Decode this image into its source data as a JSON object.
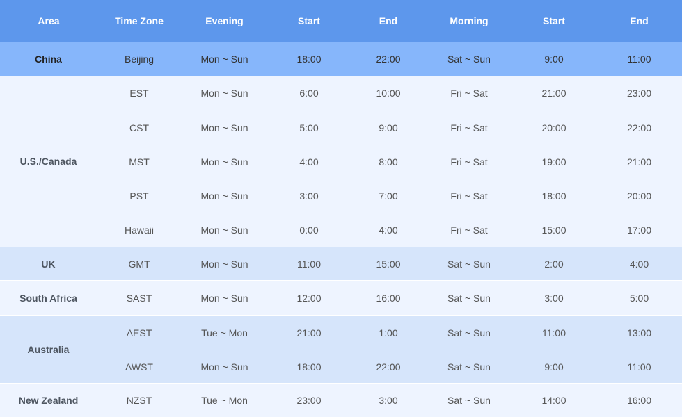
{
  "headers": [
    "Area",
    "Time Zone",
    "Evening",
    "Start",
    "End",
    "Morning",
    "Start",
    "End"
  ],
  "groups": [
    {
      "area": "China",
      "rows": [
        {
          "tz": "Beijing",
          "evening": "Mon ~ Sun",
          "e_start": "18:00",
          "e_end": "22:00",
          "morning": "Sat ~ Sun",
          "m_start": "9:00",
          "m_end": "11:00"
        }
      ]
    },
    {
      "area": "U.S./Canada",
      "rows": [
        {
          "tz": "EST",
          "evening": "Mon ~ Sun",
          "e_start": "6:00",
          "e_end": "10:00",
          "morning": "Fri ~ Sat",
          "m_start": "21:00",
          "m_end": "23:00"
        },
        {
          "tz": "CST",
          "evening": "Mon ~ Sun",
          "e_start": "5:00",
          "e_end": "9:00",
          "morning": "Fri ~ Sat",
          "m_start": "20:00",
          "m_end": "22:00"
        },
        {
          "tz": "MST",
          "evening": "Mon ~ Sun",
          "e_start": "4:00",
          "e_end": "8:00",
          "morning": "Fri ~ Sat",
          "m_start": "19:00",
          "m_end": "21:00"
        },
        {
          "tz": "PST",
          "evening": "Mon ~ Sun",
          "e_start": "3:00",
          "e_end": "7:00",
          "morning": "Fri ~ Sat",
          "m_start": "18:00",
          "m_end": "20:00"
        },
        {
          "tz": "Hawaii",
          "evening": "Mon ~ Sun",
          "e_start": "0:00",
          "e_end": "4:00",
          "morning": "Fri ~ Sat",
          "m_start": "15:00",
          "m_end": "17:00"
        }
      ]
    },
    {
      "area": "UK",
      "rows": [
        {
          "tz": "GMT",
          "evening": "Mon ~ Sun",
          "e_start": "11:00",
          "e_end": "15:00",
          "morning": "Sat ~ Sun",
          "m_start": "2:00",
          "m_end": "4:00"
        }
      ]
    },
    {
      "area": "South Africa",
      "rows": [
        {
          "tz": "SAST",
          "evening": "Mon ~ Sun",
          "e_start": "12:00",
          "e_end": "16:00",
          "morning": "Sat ~ Sun",
          "m_start": "3:00",
          "m_end": "5:00"
        }
      ]
    },
    {
      "area": "Australia",
      "rows": [
        {
          "tz": "AEST",
          "evening": "Tue ~ Mon",
          "e_start": "21:00",
          "e_end": "1:00",
          "morning": "Sat ~ Sun",
          "m_start": "11:00",
          "m_end": "13:00"
        },
        {
          "tz": "AWST",
          "evening": "Mon ~ Sun",
          "e_start": "18:00",
          "e_end": "22:00",
          "morning": "Sat ~ Sun",
          "m_start": "9:00",
          "m_end": "11:00"
        }
      ]
    },
    {
      "area": "New Zealand",
      "rows": [
        {
          "tz": "NZST",
          "evening": "Tue ~ Mon",
          "e_start": "23:00",
          "e_end": "3:00",
          "morning": "Sat ~ Sun",
          "m_start": "14:00",
          "m_end": "16:00"
        }
      ]
    }
  ],
  "colors": {
    "header_bg": "#5d97ec",
    "china_row_bg": "#86b6fb",
    "light_row_bg": "#eef4ff",
    "mid_row_bg": "#d6e5fb"
  }
}
